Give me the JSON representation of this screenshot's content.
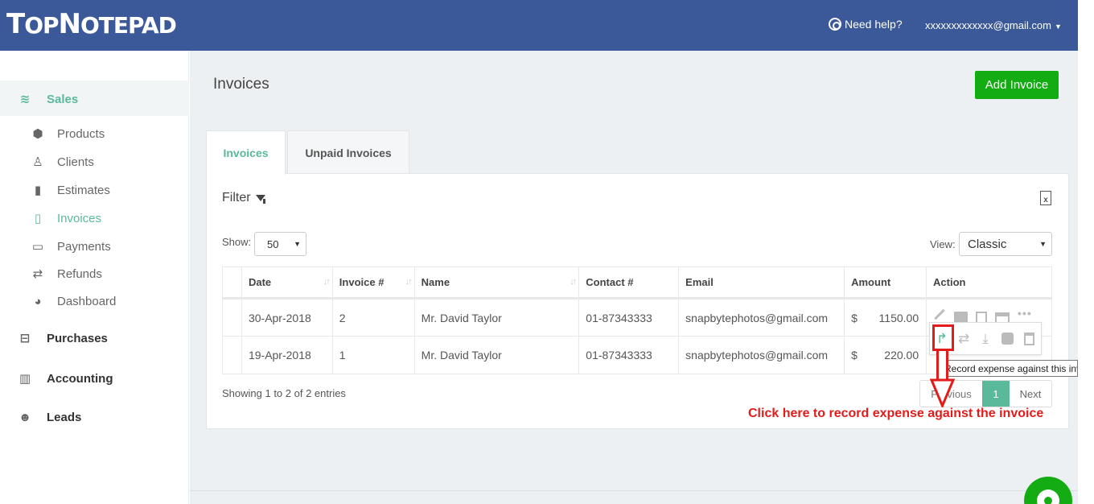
{
  "header": {
    "logo_first": "T",
    "logo_rest1": "OP",
    "logo_n": "N",
    "logo_rest2": "OTEPAD",
    "help_label": "Need help?",
    "user_email": "xxxxxxxxxxxxx@gmail.com",
    "brand_color": "#3b5998"
  },
  "sidebar": {
    "sales": "Sales",
    "sub_items": [
      {
        "label": "Products",
        "icon": "cubes-icon"
      },
      {
        "label": "Clients",
        "icon": "user-icon"
      },
      {
        "label": "Estimates",
        "icon": "file-icon"
      },
      {
        "label": "Invoices",
        "icon": "file-outline-icon",
        "active": true
      },
      {
        "label": "Payments",
        "icon": "credit-card-icon"
      },
      {
        "label": "Refunds",
        "icon": "exchange-icon"
      },
      {
        "label": "Dashboard",
        "icon": "dashboard-icon"
      }
    ],
    "purchases": "Purchases",
    "accounting": "Accounting",
    "leads": "Leads",
    "accent_color": "#5bb99b"
  },
  "page": {
    "title": "Invoices",
    "add_button": "Add Invoice",
    "tabs": [
      "Invoices",
      "Unpaid Invoices"
    ],
    "filter_label": "Filter",
    "show_label": "Show:",
    "show_value": "50",
    "view_label": "View:",
    "view_value": "Classic"
  },
  "table": {
    "headers": [
      "Date",
      "Invoice #",
      "Name",
      "Contact #",
      "Email",
      "Amount",
      "Action"
    ],
    "rows": [
      {
        "date": "30-Apr-2018",
        "invoice": "2",
        "name": "Mr. David Taylor",
        "contact": "01-87343333",
        "email": "snapbytephotos@gmail.com",
        "currency": "$",
        "amount": "1150.00"
      },
      {
        "date": "19-Apr-2018",
        "invoice": "1",
        "name": "Mr. David Taylor",
        "contact": "01-87343333",
        "email": "snapbytephotos@gmail.com",
        "currency": "$",
        "amount": "220.00"
      }
    ]
  },
  "footer": {
    "showing": "Showing 1 to 2 of 2 entries",
    "prev": "Previous",
    "page": "1",
    "next": "Next"
  },
  "tooltip": "Record expense against this invoice",
  "callout": "Click here to record expense against the invoice",
  "callout_color": "#e41b1b",
  "button_color": "#13ad13"
}
